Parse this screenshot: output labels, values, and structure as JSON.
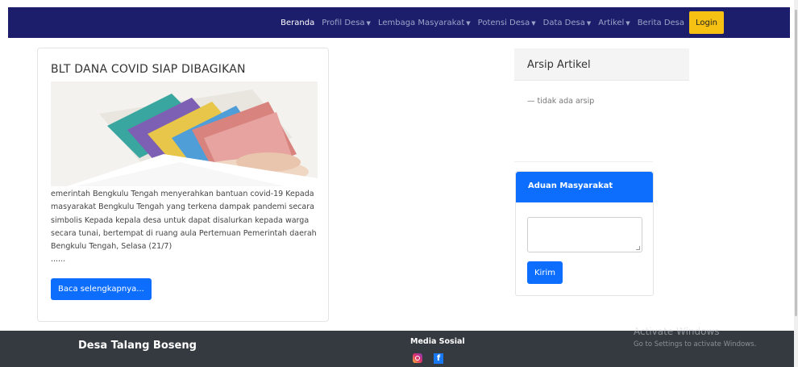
{
  "navbar": {
    "items": [
      {
        "label": "Beranda",
        "dropdown": false
      },
      {
        "label": "Profil Desa",
        "dropdown": true
      },
      {
        "label": "Lembaga Masyarakat",
        "dropdown": true
      },
      {
        "label": "Potensi Desa",
        "dropdown": true
      },
      {
        "label": "Data Desa",
        "dropdown": true
      },
      {
        "label": "Artikel",
        "dropdown": true
      },
      {
        "label": "Berita Desa",
        "dropdown": false
      }
    ],
    "caret": "▼",
    "login_label": "Login"
  },
  "article": {
    "title": "BLT DANA COVID SIAP DIBAGIKAN",
    "excerpt": "emerintah Bengkulu Tengah menyerahkan bantuan covid-19 Kepada masyarakat Bengkulu Tengah yang terkena dampak pandemi secara simbolis Kepada kepala desa untuk dapat disalurkan kepada warga secara tunai, bertempat di ruang aula Pertemuan Pemerintah daerah Bengkulu Tengah, Selasa (21/7)",
    "ellipsis": "......",
    "read_more_label": "Baca selengkapnya..."
  },
  "archive": {
    "title": "Arsip Artikel",
    "empty_text": "— tidak ada arsip"
  },
  "aduan": {
    "title": "Aduan Masyarakat",
    "textarea_value": "",
    "submit_label": "Kirim"
  },
  "footer": {
    "brand": "Desa Talang Boseng",
    "social_title": "Media Sosial",
    "facebook_glyph": "f"
  },
  "watermark": {
    "title": "Activate Windows",
    "subtitle": "Go to Settings to activate Windows."
  },
  "colors": {
    "navbar": "#1c1e6b",
    "primary": "#0d6efd",
    "login": "#f6c112",
    "footer": "#343a40"
  }
}
